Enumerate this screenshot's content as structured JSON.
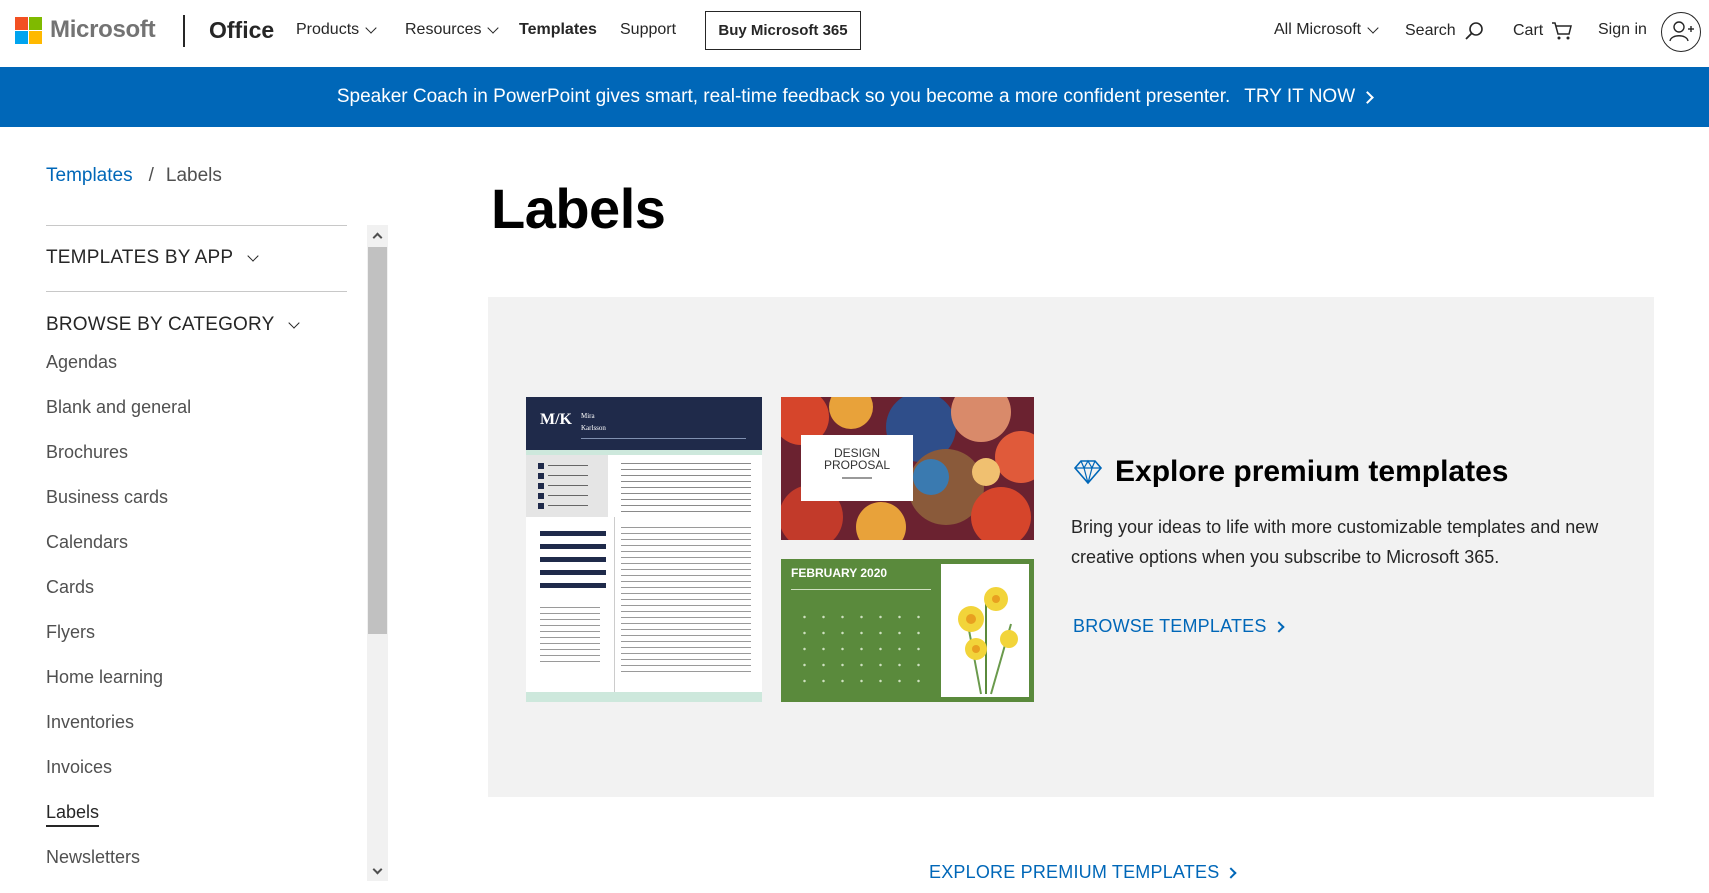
{
  "header": {
    "brand": "Microsoft",
    "product": "Office",
    "nav": [
      {
        "label": "Products",
        "dropdown": true
      },
      {
        "label": "Resources",
        "dropdown": true
      },
      {
        "label": "Templates",
        "dropdown": false
      },
      {
        "label": "Support",
        "dropdown": false
      }
    ],
    "buy_button": "Buy Microsoft 365",
    "all_microsoft": "All Microsoft",
    "search": "Search",
    "cart": "Cart",
    "sign_in": "Sign in"
  },
  "banner": {
    "text": "Speaker Coach in PowerPoint gives smart, real-time feedback so you become a more confident presenter.",
    "cta": "TRY IT NOW",
    "bg_color": "#0067b8"
  },
  "breadcrumb": {
    "parent": "Templates",
    "separator": "/",
    "current": "Labels"
  },
  "sidebar": {
    "templates_by_app": "TEMPLATES BY APP",
    "browse_by_category": "BROWSE BY CATEGORY",
    "categories": [
      {
        "label": "Agendas",
        "active": false
      },
      {
        "label": "Blank and general",
        "active": false
      },
      {
        "label": "Brochures",
        "active": false
      },
      {
        "label": "Business cards",
        "active": false
      },
      {
        "label": "Calendars",
        "active": false
      },
      {
        "label": "Cards",
        "active": false
      },
      {
        "label": "Flyers",
        "active": false
      },
      {
        "label": "Home learning",
        "active": false
      },
      {
        "label": "Inventories",
        "active": false
      },
      {
        "label": "Invoices",
        "active": false
      },
      {
        "label": "Labels",
        "active": true
      },
      {
        "label": "Newsletters",
        "active": false
      }
    ]
  },
  "main": {
    "title": "Labels",
    "promo": {
      "title": "Explore premium templates",
      "description": "Bring your ideas to life with more customizable templates and new creative options when you subscribe to Microsoft 365.",
      "link": "BROWSE TEMPLATES",
      "resume": {
        "monogram": "M/K",
        "first_name": "Mira",
        "last_name": "Karlsson"
      },
      "proposal": {
        "title_line1": "DESIGN",
        "title_line2": "PROPOSAL"
      },
      "calendar": {
        "month": "FEBRUARY 2020"
      }
    },
    "explore_link": "EXPLORE PREMIUM TEMPLATES"
  },
  "colors": {
    "link_blue": "#0067b8",
    "promo_bg": "#f2f2f2",
    "calendar_green": "#5a8a3c",
    "resume_navy": "#1f2a4a"
  }
}
